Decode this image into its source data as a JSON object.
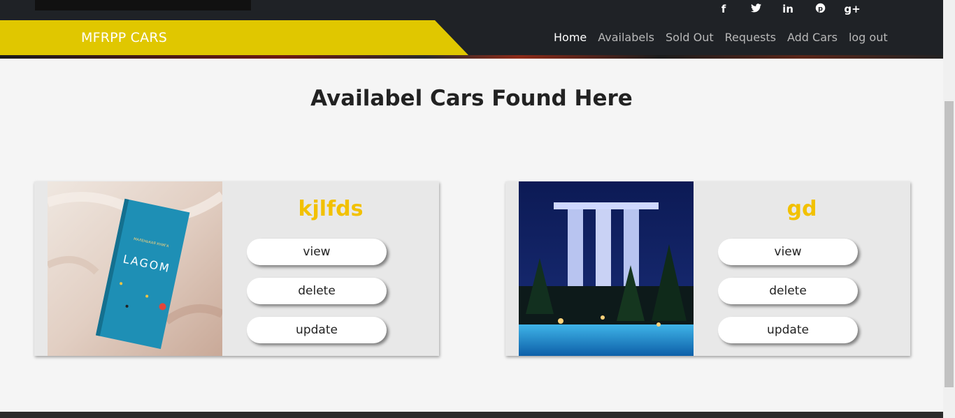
{
  "brand": "MFRPP CARS",
  "social": [
    {
      "icon": "facebook-icon",
      "glyph": "f"
    },
    {
      "icon": "twitter-icon",
      "glyph": "🐦"
    },
    {
      "icon": "linkedin-icon",
      "glyph": "in"
    },
    {
      "icon": "pinterest-icon",
      "glyph": "℗"
    },
    {
      "icon": "google-plus-icon",
      "glyph": "g+"
    }
  ],
  "nav": [
    "Home",
    "Availabels",
    "Sold Out",
    "Requests",
    "Add Cars",
    "log out"
  ],
  "page_title": "Availabel Cars Found Here",
  "cards": [
    {
      "name": "kjlfds",
      "view": "view",
      "delete": "delete",
      "update": "update",
      "image": "blue-book-on-bed"
    },
    {
      "name": "gd",
      "view": "view",
      "delete": "delete",
      "update": "update",
      "image": "night-hotel-pool"
    }
  ],
  "colors": {
    "accent": "#e0c700",
    "name": "#f2c100",
    "dark": "#1f2226"
  }
}
